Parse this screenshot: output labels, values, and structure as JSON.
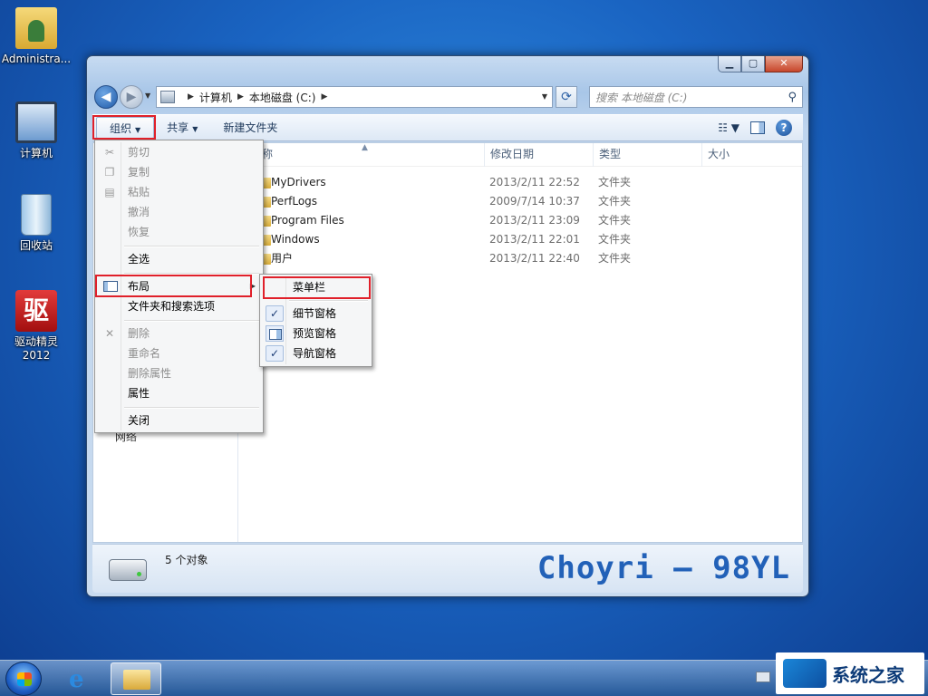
{
  "desktop": {
    "icons": [
      {
        "label": "Administra..."
      },
      {
        "label": "计算机"
      },
      {
        "label": "回收站"
      },
      {
        "label": "驱动精灵\n2012",
        "line1": "驱动精灵",
        "line2": "2012",
        "glyph": "驱"
      }
    ]
  },
  "window": {
    "caption": {
      "min": "▁",
      "max": "▢",
      "close": "✕"
    },
    "address": {
      "crumbs": [
        "计算机",
        "本地磁盘 (C:)"
      ],
      "search_placeholder": "搜索 本地磁盘 (C:)"
    },
    "toolbar": {
      "organize": "组织",
      "share": "共享",
      "new_folder": "新建文件夹"
    },
    "columns": {
      "name": "称",
      "date": "修改日期",
      "type": "类型",
      "size": "大小"
    },
    "files": [
      {
        "name": "MyDrivers",
        "date": "2013/2/11 22:52",
        "type": "文件夹"
      },
      {
        "name": "PerfLogs",
        "date": "2009/7/14 10:37",
        "type": "文件夹"
      },
      {
        "name": "Program Files",
        "date": "2013/2/11 23:09",
        "type": "文件夹"
      },
      {
        "name": "Windows",
        "date": "2013/2/11 22:01",
        "type": "文件夹"
      },
      {
        "name": "用户",
        "date": "2013/2/11 22:40",
        "type": "文件夹"
      }
    ],
    "nav_pane": {
      "network_partial": "网络"
    },
    "details": {
      "object_count": "5 个对象",
      "watermark": "Choyri — 98YL"
    }
  },
  "organize_menu": {
    "items": {
      "cut": "剪切",
      "copy": "复制",
      "paste": "粘贴",
      "undo": "撤消",
      "redo": "恢复",
      "select_all": "全选",
      "layout": "布局",
      "folder_options": "文件夹和搜索选项",
      "delete": "删除",
      "rename": "重命名",
      "remove_props": "删除属性",
      "properties": "属性",
      "close": "关闭"
    }
  },
  "layout_submenu": {
    "menu_bar": "菜单栏",
    "details_pane": "细节窗格",
    "preview_pane": "预览窗格",
    "navigation_pane": "导航窗格"
  },
  "taskbar": {
    "logo_text": "系统之家"
  },
  "colors": {
    "highlight_border": "#e0202a",
    "watermark": "#2261b8"
  }
}
